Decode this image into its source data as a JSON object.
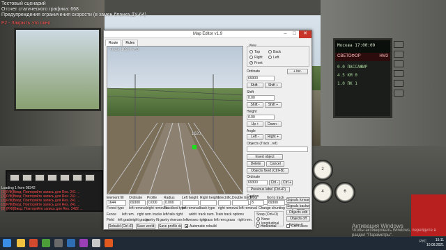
{
  "hud": {
    "line1": "Тестовый сценарий",
    "line2": "Отсчет статического графика: 668",
    "line3": "Предупреждения ограничения скорости (в замен бланка ДУ-64)",
    "line4": "F2 - Закрыть это окно"
  },
  "log_lines": [
    "Loading 1 from 08342",
    "[3][Р/Ф]Ввод: Повторяйте запись для Res. 241 ...",
    "[3][Р/Ф]Ввод: Повторяйте запись для Res. 241 ...",
    "[3][Р/Ф]Ввод: Повторяйте запись для Res. 241 ...",
    "[3][Р/Ф]Ввод: Повторяйте запись для Res. 241 ...",
    "[3] [Р/Ф]Ввод: Повторяйте запись для Res. 2422 ..."
  ],
  "control_display": {
    "clock": "Москва 17:00:09",
    "status": "СВЕТОФОР",
    "code": "НМ3",
    "rows": [
      "0.0  ПАССАЖИР",
      "4.5  КМ  0",
      "1.0  ПК  1"
    ]
  },
  "map_editor": {
    "title": "Map Editor v1.9",
    "tabs": [
      "Route",
      "Rules"
    ],
    "viewport_overlay": "Track 1620  A+B",
    "viewport_label": "1620",
    "view_group": {
      "label": "View",
      "options": [
        "Top",
        "Back",
        "Right",
        "Left",
        "Front"
      ],
      "selected": "Front"
    },
    "ordinate": {
      "label": "Ordinate",
      "plus_label": "+ inc.",
      "value": "69300",
      "shift_minus": "Shift -",
      "shift_plus": "Shift +"
    },
    "shift": {
      "label": "Shift",
      "value": "0.00",
      "minus": "Shift -",
      "plus": "Shift +"
    },
    "height": {
      "label": "Height",
      "value": "0.00"
    },
    "up_label": "Up +",
    "down_label": "Down -",
    "angle": {
      "label": "Angle",
      "left": "Left -",
      "right": "Right +"
    },
    "object_label": "Objects (Track ..ref)",
    "insert_object": "Insert object",
    "delete_button": "Delete",
    "cancel_button": "Cancel",
    "objects_fixed": "Objects fixed (Ctrl+B)",
    "ordinate2_label": "Ordinate",
    "ordinate2_value": "69300",
    "ctrl_minus": "Ctrl -",
    "ctrl_plus": "Ctrl +",
    "previous_label": "Previous label (Ctrl+P)",
    "caption_label": "Caption",
    "clear_button": "Clear",
    "fields": {
      "element_fill": "Element fill",
      "element_fill_value": "1644",
      "ordinate": "Ordinate",
      "ordinate_value": "69300",
      "profile": "Profile",
      "profile_value": "0.000",
      "radius": "Radius",
      "radius_value": "0.000",
      "left_height": "Left height",
      "right_height": "Right height",
      "electric": "Electrific.",
      "double_track": "Double track",
      "hour": "Hour",
      "hour_value": "8",
      "go_to_track": "Go to track",
      "go_to_value": "69300"
    },
    "row2": [
      "Forest type",
      "left removal",
      "right removal",
      "Trackbed type",
      "left removal",
      "back type",
      "right removal",
      "left removal"
    ],
    "row3": [
      "Fence",
      "left rem.",
      "right rem.",
      "tracks left/rails right",
      "addit. track num.",
      "Train track options"
    ],
    "row4": [
      "Field",
      "left grade",
      "right grade",
      "gantry lft",
      "gantry rt",
      "verses left",
      "verses right",
      "grass",
      "left rem.",
      "grass",
      "right rem."
    ],
    "buttons": {
      "signals_forward": "Signals forward",
      "signals_backward": "Signals backward",
      "objects_edit": "Objects edit",
      "objects_off": "Objects off",
      "errors": "Errors: 4"
    },
    "change_shunting": "Change shunting",
    "snap_group": {
      "label": "Snap (Ctrl+O)",
      "options": [
        "None",
        "longitudinal",
        "Horizontal"
      ],
      "selected": "None"
    },
    "coll_faces": "Coll Faces",
    "rebuild": "Rebuild (Ctrl+R)",
    "save_world": "Save world",
    "save_profile": "Save profile dat",
    "automatic_rebuild": "Automatic rebuild",
    "automatic_rebuild_checked": true
  },
  "gauges": [
    "2",
    "4",
    "6"
  ],
  "watermark": {
    "line1": "Активация Windows",
    "line2": "Чтобы активировать Windows, перейдите в",
    "line3": "раздел \"Параметры\"."
  },
  "taskbar": {
    "tray_lang": "РУС",
    "time": "15:11",
    "date": "10.08.2021"
  }
}
